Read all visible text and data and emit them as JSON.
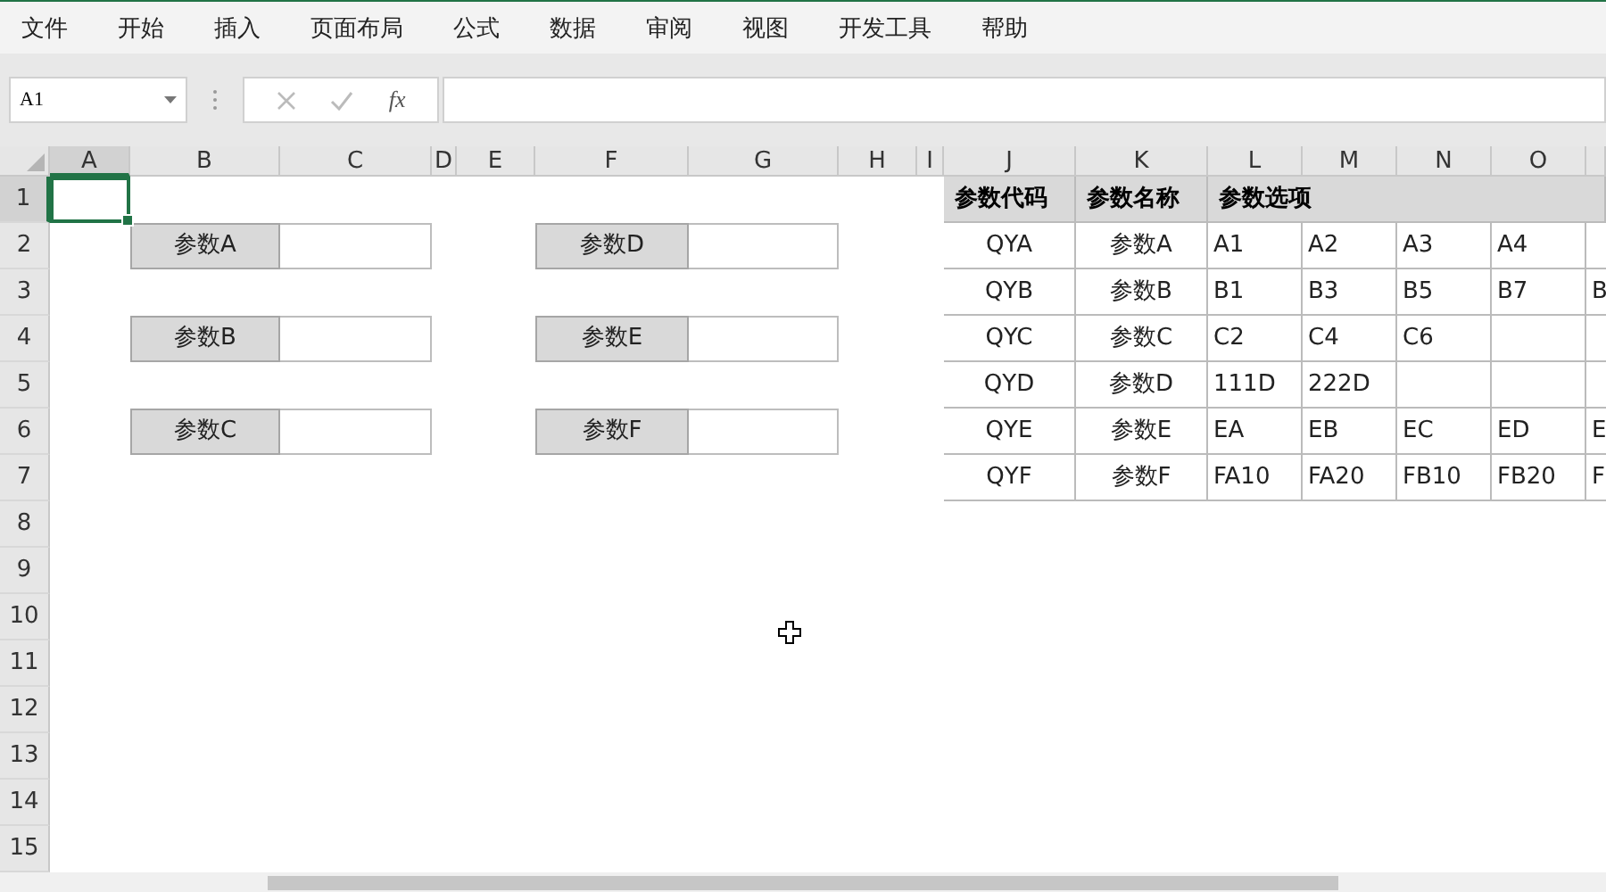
{
  "menu": [
    {
      "label": "文件"
    },
    {
      "label": "开始"
    },
    {
      "label": "插入"
    },
    {
      "label": "页面布局"
    },
    {
      "label": "公式"
    },
    {
      "label": "数据"
    },
    {
      "label": "审阅"
    },
    {
      "label": "视图"
    },
    {
      "label": "开发工具"
    },
    {
      "label": "帮助"
    }
  ],
  "formula_bar": {
    "name_box": "A1",
    "function_label": "fx"
  },
  "columns": [
    {
      "label": "A",
      "selected": true
    },
    {
      "label": "B",
      "selected": false
    },
    {
      "label": "C",
      "selected": false
    },
    {
      "label": "D",
      "selected": false
    },
    {
      "label": "E",
      "selected": false
    },
    {
      "label": "F",
      "selected": false
    },
    {
      "label": "G",
      "selected": false
    },
    {
      "label": "H",
      "selected": false
    },
    {
      "label": "I",
      "selected": false
    },
    {
      "label": "J",
      "selected": false
    },
    {
      "label": "K",
      "selected": false
    },
    {
      "label": "L",
      "selected": false
    },
    {
      "label": "M",
      "selected": false
    },
    {
      "label": "N",
      "selected": false
    },
    {
      "label": "O",
      "selected": false
    }
  ],
  "rows": [
    {
      "label": "1",
      "selected": true
    },
    {
      "label": "2",
      "selected": false
    },
    {
      "label": "3",
      "selected": false
    },
    {
      "label": "4",
      "selected": false
    },
    {
      "label": "5",
      "selected": false
    },
    {
      "label": "6",
      "selected": false
    },
    {
      "label": "7",
      "selected": false
    },
    {
      "label": "8",
      "selected": false
    },
    {
      "label": "9",
      "selected": false
    },
    {
      "label": "10",
      "selected": false
    },
    {
      "label": "11",
      "selected": false
    },
    {
      "label": "12",
      "selected": false
    },
    {
      "label": "13",
      "selected": false
    },
    {
      "label": "14",
      "selected": false
    },
    {
      "label": "15",
      "selected": false
    }
  ],
  "input_panel": [
    {
      "label": "参数A"
    },
    {
      "label": "参数B"
    },
    {
      "label": "参数C"
    },
    {
      "label": "参数D"
    },
    {
      "label": "参数E"
    },
    {
      "label": "参数F"
    }
  ],
  "lookup_table": {
    "headers": [
      "参数代码",
      "参数名称",
      "参数选项"
    ],
    "rows": [
      {
        "code": "QYA",
        "name": "参数A",
        "options": [
          "A1",
          "A2",
          "A3",
          "A4"
        ]
      },
      {
        "code": "QYB",
        "name": "参数B",
        "options": [
          "B1",
          "B3",
          "B5",
          "B7",
          "B"
        ]
      },
      {
        "code": "QYC",
        "name": "参数C",
        "options": [
          "C2",
          "C4",
          "C6"
        ]
      },
      {
        "code": "QYD",
        "name": "参数D",
        "options": [
          "111D",
          "222D"
        ]
      },
      {
        "code": "QYE",
        "name": "参数E",
        "options": [
          "EA",
          "EB",
          "EC",
          "ED",
          "E"
        ]
      },
      {
        "code": "QYF",
        "name": "参数F",
        "options": [
          "FA10",
          "FA20",
          "FB10",
          "FB20",
          "F"
        ]
      }
    ]
  }
}
